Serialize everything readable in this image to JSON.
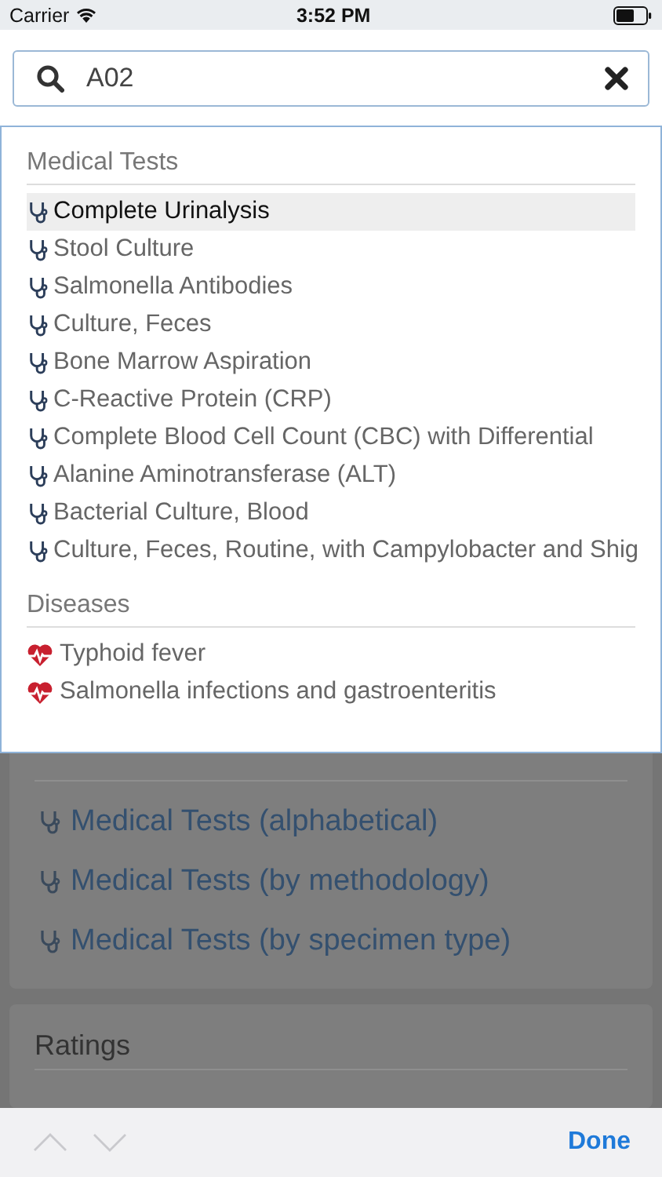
{
  "status_bar": {
    "carrier": "Carrier",
    "time": "3:52 PM"
  },
  "search": {
    "value": "A02"
  },
  "suggestions": [
    {
      "title": "Medical Tests",
      "kind": "test",
      "items": [
        {
          "label": "Complete Urinalysis",
          "selected": true
        },
        {
          "label": "Stool Culture",
          "selected": false
        },
        {
          "label": "Salmonella Antibodies",
          "selected": false
        },
        {
          "label": "Culture, Feces",
          "selected": false
        },
        {
          "label": "Bone Marrow Aspiration",
          "selected": false
        },
        {
          "label": "C-Reactive Protein (CRP)",
          "selected": false
        },
        {
          "label": "Complete Blood Cell Count (CBC) with Differential",
          "selected": false
        },
        {
          "label": "Alanine Aminotransferase (ALT)",
          "selected": false
        },
        {
          "label": "Bacterial Culture, Blood",
          "selected": false
        },
        {
          "label": "Culture, Feces, Routine, with Campylobacter and Shig",
          "selected": false
        }
      ]
    },
    {
      "title": "Diseases",
      "kind": "disease",
      "items": [
        {
          "label": "Typhoid fever",
          "selected": false
        },
        {
          "label": "Salmonella infections and gastroenteritis",
          "selected": false
        }
      ]
    }
  ],
  "cards": [
    {
      "links": [
        "Medical Tests (alphabetical)",
        "Medical Tests (by methodology)",
        "Medical Tests (by specimen type)"
      ]
    },
    {
      "title": "Ratings"
    }
  ],
  "toolbar": {
    "previous": {
      "disabled": true
    },
    "next": {
      "disabled": true
    },
    "done": "Done"
  }
}
